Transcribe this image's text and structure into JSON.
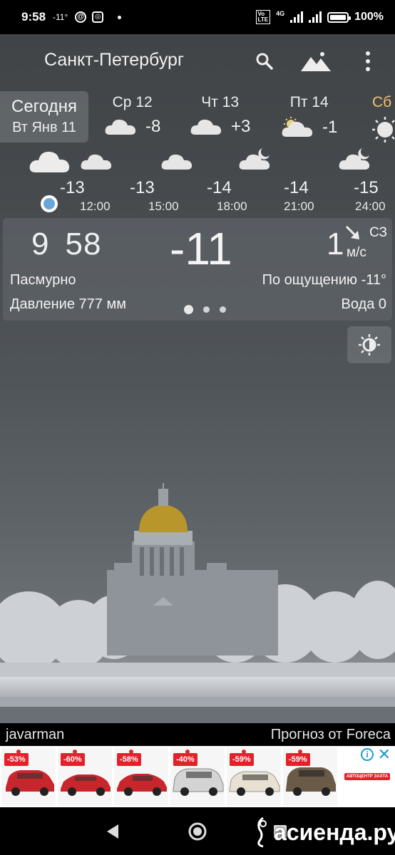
{
  "status_bar": {
    "time": "9:58",
    "temp_small": "-11°",
    "network": "4G",
    "battery": "100%"
  },
  "header": {
    "city": "Санкт-Петербург"
  },
  "days": {
    "today_label": "Сегодня",
    "today_date": "Вт Янв 11",
    "items": [
      {
        "name": "Ср 12",
        "temp": "-8",
        "icon": "cloud-icon"
      },
      {
        "name": "Чт 13",
        "temp": "+3",
        "icon": "cloud-icon"
      },
      {
        "name": "Пт 14",
        "temp": "-1",
        "icon": "partly-cloudy-icon"
      },
      {
        "name": "Сб",
        "temp": "",
        "icon": "sun-icon"
      }
    ]
  },
  "hourly": [
    {
      "temp": "-13",
      "time": "12:00"
    },
    {
      "temp": "-13",
      "time": "15:00"
    },
    {
      "temp": "-14",
      "time": "18:00"
    },
    {
      "temp": "-14",
      "time": "21:00"
    },
    {
      "temp": "-15",
      "time": "24:00"
    }
  ],
  "current": {
    "time_h": "9",
    "time_m": "58",
    "temp": "-11",
    "wind_speed": "1",
    "wind_unit": "м/с",
    "wind_dir": "СЗ",
    "condition": "Пасмурно",
    "feels_like": "По ощущению -11°",
    "pressure": "Давление 777 мм",
    "water": "Вода 0"
  },
  "footer": {
    "author": "javarman",
    "provider": "Прогноз от Foreca"
  },
  "ads": [
    {
      "discount": "-53%",
      "color": "#c8262c"
    },
    {
      "discount": "-60%",
      "color": "#c8262c"
    },
    {
      "discount": "-58%",
      "color": "#c8262c"
    },
    {
      "discount": "-40%",
      "color": "#d8d8d8"
    },
    {
      "discount": "-59%",
      "color": "#e8e0d0"
    },
    {
      "discount": "-59%",
      "color": "#6a5a48"
    }
  ],
  "ad_brand": "АВТОЦЕНТР ЗАХТА",
  "watermark": "асиенда.ру"
}
